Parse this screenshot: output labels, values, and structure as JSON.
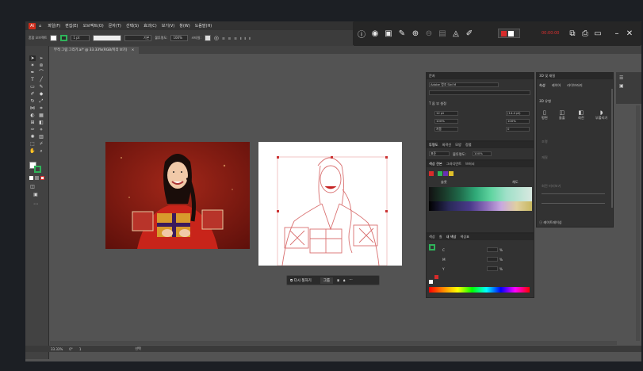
{
  "menu": {
    "items": [
      "파일(F)",
      "편집(E)",
      "오브젝트(O)",
      "문자(T)",
      "선택(S)",
      "효과(C)",
      "보기(V)",
      "창(W)",
      "도움말(H)"
    ]
  },
  "float_toolbar": {
    "record_label": "00:00:00",
    "icons": [
      "info-circle-icon",
      "stop-circle-icon",
      "note-icon",
      "pen-icon",
      "zoom-in-icon",
      "zoom-out-icon",
      "layout-icon",
      "bucket-icon",
      "text-pen-icon",
      "color-picker-icon",
      "record-indicator-icon",
      "crop-icon",
      "capture-icon",
      "monitor-icon",
      "minimize-icon",
      "close-icon"
    ]
  },
  "controlbar": {
    "selection_label": "혼합 오브젝트",
    "stroke_label": "1 pt",
    "brush_label": "기본",
    "opacity_label": "불투명도:",
    "opacity_value": "100%",
    "style_label": "스타일:"
  },
  "document_tab": {
    "title": "부적 그림 그리기.ai* @ 33.33%(RGB/미리 보기)",
    "close": "×"
  },
  "character_panel": {
    "title": "문자",
    "font_family": "Adobe 명조 Std M",
    "font_style": "",
    "option_label": "T 옵 부 설정",
    "size": "12 pt",
    "leading": "(14.4 pt)",
    "scale_v": "100%",
    "scale_h": "100%",
    "tracking": "자동",
    "kerning": "0",
    "rotation": "0"
  },
  "transparency_panel": {
    "tabs": [
      "투명도",
      "외곽선",
      "모양",
      "정렬"
    ],
    "mode": "표준",
    "opacity_label": "불투명도:",
    "opacity_value": "100%"
  },
  "swatches_panel": {
    "tabs": [
      "색상 견본",
      "그라디언트",
      "브러시"
    ],
    "group1": "슬롯",
    "group2": "채도"
  },
  "color_panel": {
    "tabs": [
      "칠",
      "내 색상",
      "색상표"
    ],
    "tab_prefix": "색상",
    "c_label": "C",
    "m_label": "M",
    "y_label": "Y",
    "percent": "%"
  },
  "properties_panel": {
    "tabs": [
      "3D 및 재질",
      "속성",
      "레이어",
      "라이브러리"
    ],
    "section_title": "3D 유형",
    "types": [
      "평면",
      "돌출",
      "회전",
      "부풀리기"
    ],
    "rows": [
      "조명",
      "재질",
      "회전 미리보기"
    ],
    "footer": "레이트레이싱"
  },
  "context_bar": {
    "redraw_label": "다시 칠하기",
    "group_label": "그룹",
    "more_label": "···"
  },
  "statusbar": {
    "zoom": "33.33%",
    "angle": "0°",
    "artboard": "1",
    "mode": "선택"
  },
  "colors": {
    "accent_red": "#d82b2b",
    "photo_bg": "#8b1a12",
    "line_art": "#d97070",
    "swatch_green": "#2fb35a"
  }
}
